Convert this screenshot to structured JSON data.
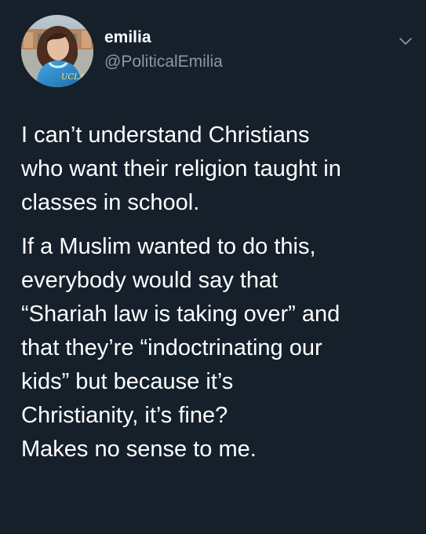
{
  "tweet": {
    "author": {
      "display_name": "emilia",
      "handle": "@PoliticalEmilia",
      "avatar_icon": "profile-photo-avatar"
    },
    "menu_icon": "chevron-down-icon",
    "paragraphs": [
      {
        "lines": [
          "I can’t understand Christians",
          "who want their religion taught in",
          "classes in school."
        ]
      },
      {
        "lines": [
          "If a Muslim wanted to do this,",
          "everybody would say that",
          "“Shariah law is taking over” and",
          "that they’re “indoctrinating our",
          "kids” but because it’s",
          "Christianity, it’s fine?",
          "Makes no sense to me."
        ]
      }
    ],
    "colors": {
      "background": "#15202b",
      "primary_text": "#ffffff",
      "secondary_text": "#8899a6",
      "caret": "#8899a6"
    }
  }
}
